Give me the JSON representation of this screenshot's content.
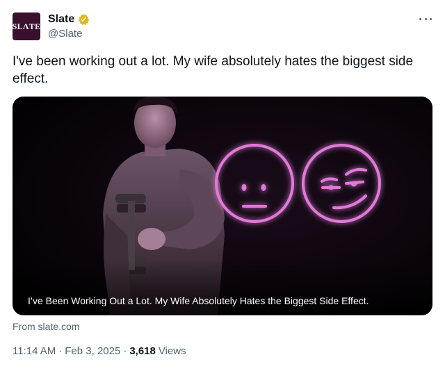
{
  "account": {
    "avatar_text": "SLΛTE",
    "name": "Slate",
    "handle": "@Slate",
    "verified_icon": "verified-gold-badge-icon"
  },
  "tweet": {
    "text": "I've been working out a lot. My wife absolutely hates the biggest side effect.",
    "media_caption": "I’ve Been Working Out a Lot. My Wife Absolutely Hates the Biggest Side Effect.",
    "source": "From slate.com",
    "time": "11:14 AM",
    "date": "Feb 3, 2025",
    "separator": "·",
    "views_count": "3,618",
    "views_label": "Views"
  },
  "icons": {
    "more": "more-horizontal-icon"
  },
  "colors": {
    "avatar_bg": "#3b0f2e",
    "neon": "#e07ad8",
    "verified": "#e2b719",
    "secondary_text": "#536471"
  }
}
